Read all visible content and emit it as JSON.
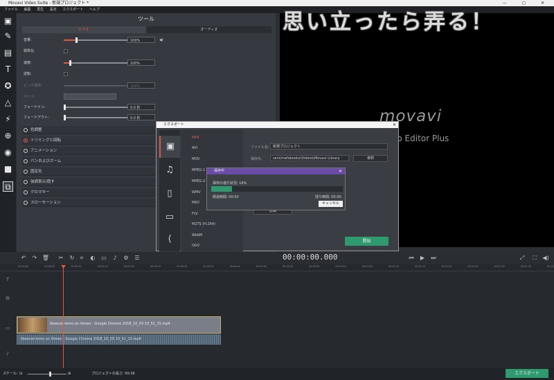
{
  "window": {
    "title": "Movavi Video Suite - 新規プロジェクト *",
    "controls": "— ▢ ✕"
  },
  "menu": [
    "ファイル",
    "編集",
    "再生",
    "設定",
    "エクスポート",
    "ヘルプ"
  ],
  "banner_text": "思い立ったら弄る！",
  "tools_panel": {
    "title": "ツール",
    "tabs": [
      "ビデオ",
      "オーディオ"
    ],
    "rows": [
      {
        "label": "音量:",
        "value": "100%",
        "fill": 0.17
      },
      {
        "label": "標準化:"
      },
      {
        "label": "速度:",
        "value": "100%",
        "fill": 0.08
      },
      {
        "label": "逆転:"
      },
      {
        "label": "ピッチ保持:",
        "value": "100%"
      },
      {
        "label": "ボイス:"
      },
      {
        "label": "フェードイン:",
        "value": "0.0 秒"
      },
      {
        "label": "フェードアウト:",
        "value": "0.0 秒"
      }
    ],
    "effects": [
      "色調整",
      "トリミングと回転",
      "アニメーション",
      "パンおよびズーム",
      "固定化",
      "強調表示/隠す",
      "クロマキー",
      "スローモーション"
    ]
  },
  "preview": {
    "logo": "movavi",
    "subtitle": "eo Editor Plus"
  },
  "toolbar": {
    "timecode": "00:00:00.000"
  },
  "ruler_ticks": [
    "00:00:00",
    "00:00:05",
    "00:00:10",
    "00:00:15",
    "00:00:20",
    "00:00:25",
    "00:00:30",
    "00:00:35",
    "00:00:40",
    "00:00:45",
    "00:00:50",
    "00:00:55",
    "00:01:00",
    "00:01:05",
    "00:01:10",
    "00:01:15",
    "00:01:20",
    "00:01:25",
    "00:01:30",
    "00:01:35",
    "00:01:40"
  ],
  "timeline": {
    "video_clip": "Newvoir-lemo on Vimeo - Google Chrome 2018_10_03 10_51_15.mp4",
    "audio_clip": "Newvoir-lemo on Vimeo - Google Chrome 2018_10_03 10_51_15.mp4"
  },
  "statusbar": {
    "scale_label": "スケール:",
    "duration": "プロジェクトの長さ: 00:36",
    "export_label": "エクスポート"
  },
  "export_dialog": {
    "title": "エクスポート",
    "formats": [
      "MP4",
      "AVI",
      "MOV",
      "MPEG-1",
      "MPEG-2",
      "WMV",
      "MKV",
      "FLV",
      "M2TS (H.264)",
      "WebM",
      "OGV"
    ],
    "file_label": "ファイル名:",
    "file_value": "新規プロジェクト",
    "save_label": "保存先:",
    "save_value": "sers\\mefebookx\\Videos\\Movavi Library",
    "browse_label": "参照",
    "detail_label": "詳細",
    "start_label": "開始"
  },
  "progress_dialog": {
    "title": "保存中",
    "status": "保存の進行状況: 16%",
    "progress": 0.16,
    "elapsed": "経過時間: 00:03",
    "remaining": "残り時間: 00:00",
    "cancel_label": "キャンセル"
  }
}
